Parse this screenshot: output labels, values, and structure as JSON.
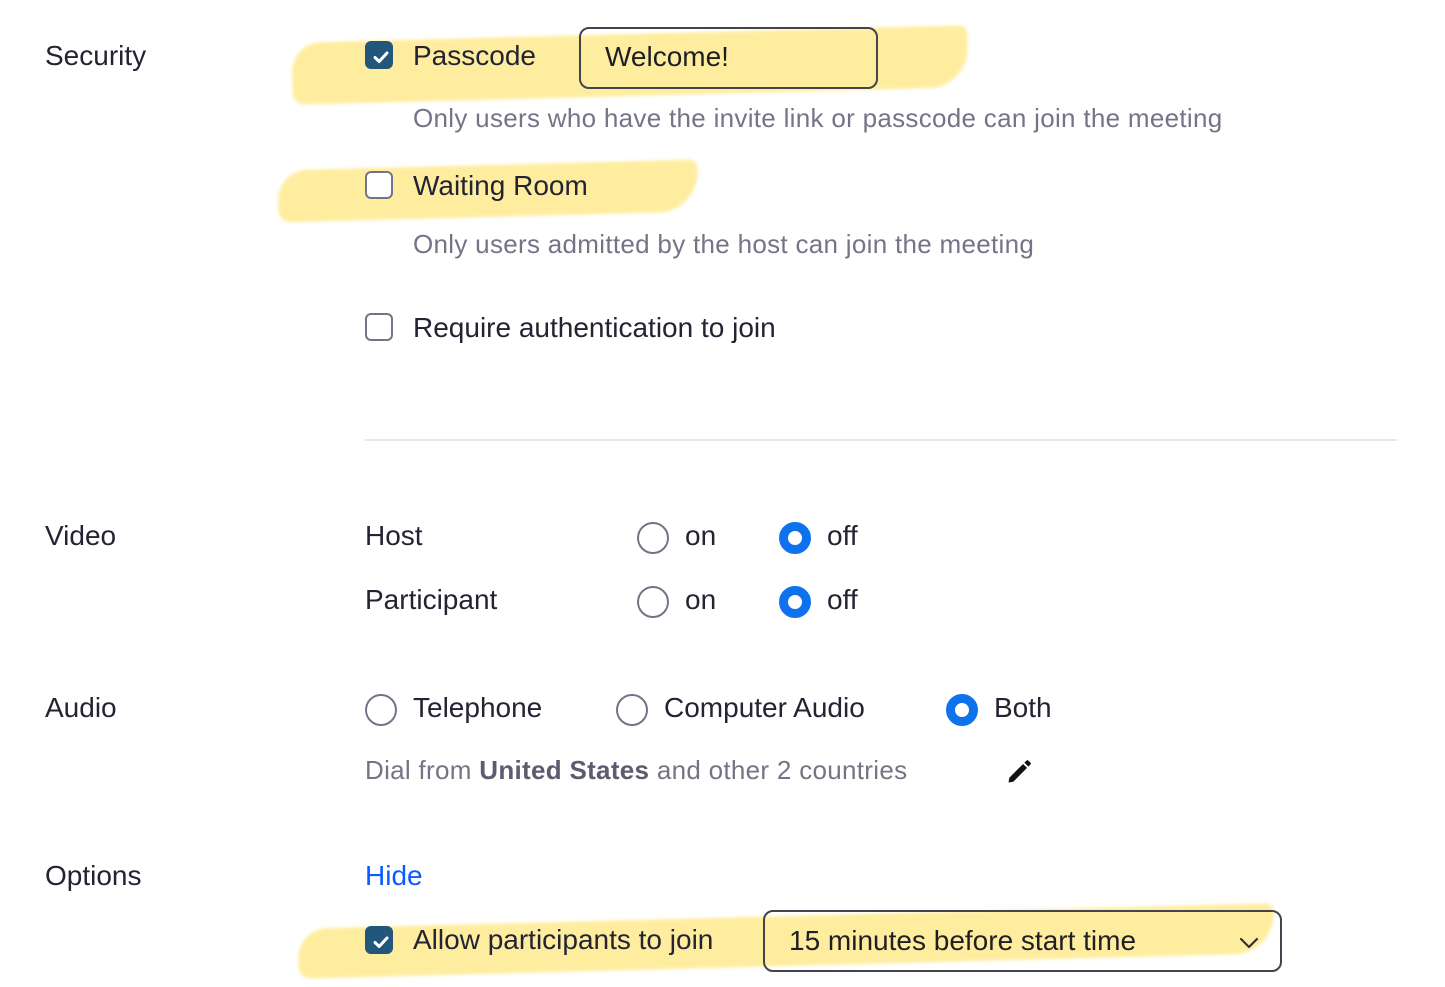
{
  "security": {
    "label": "Security",
    "passcode": {
      "label": "Passcode",
      "checked": true,
      "value": "Welcome!",
      "hint": "Only users who have the invite link or passcode can join the meeting"
    },
    "waiting_room": {
      "label": "Waiting Room",
      "checked": false,
      "hint": "Only users admitted by the host can join the meeting"
    },
    "require_auth": {
      "label": "Require authentication to join",
      "checked": false
    }
  },
  "video": {
    "label": "Video",
    "host": {
      "label": "Host",
      "on": "on",
      "off": "off",
      "selected": "off"
    },
    "participant": {
      "label": "Participant",
      "on": "on",
      "off": "off",
      "selected": "off"
    }
  },
  "audio": {
    "label": "Audio",
    "options": [
      "Telephone",
      "Computer Audio",
      "Both"
    ],
    "selected": "Both",
    "dial_prefix": "Dial from",
    "dial_country": "United States",
    "dial_suffix": "and other 2 countries"
  },
  "options": {
    "label": "Options",
    "toggle": "Hide",
    "allow_join": {
      "label": "Allow participants to join",
      "checked": true,
      "selected_value": "15 minutes before start time"
    }
  },
  "colors": {
    "accent": "#0e72ed",
    "checkbox": "#23567b",
    "highlight": "#ffde50",
    "link": "#0b5cff"
  }
}
